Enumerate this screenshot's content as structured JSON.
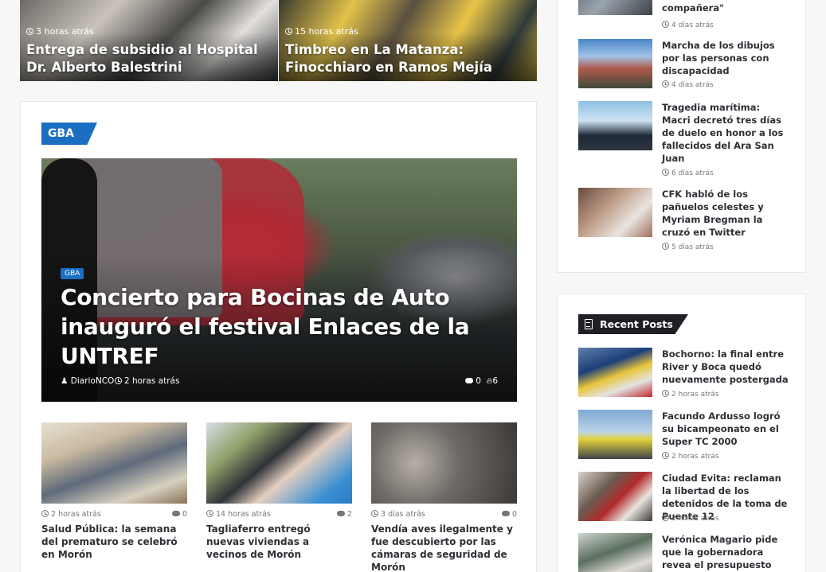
{
  "top_cards": [
    {
      "time": "3 horas atrás",
      "title": "Entrega de subsidio al Hospital Dr. Alberto Balestrini"
    },
    {
      "time": "15 horas atrás",
      "title": "Timbreo en La Matanza: Finocchiaro en Ramos Mejía"
    }
  ],
  "main": {
    "section_label": "GBA",
    "hero": {
      "badge": "GBA",
      "title": "Concierto para Bocinas de Auto inauguró el festival Enlaces de la UNTREF",
      "author": "DiarioNCO",
      "time": "2 horas atrás",
      "comments": "0",
      "views": "6"
    },
    "grid": [
      {
        "time": "2 horas atrás",
        "comments": "0",
        "title": "Salud Pública: la semana del prematuro se celebró en Morón"
      },
      {
        "time": "14 horas atrás",
        "comments": "2",
        "title": "Tagliaferro entregó nuevas viviendas a vecinos de Morón"
      },
      {
        "time": "3 días atrás",
        "comments": "0",
        "title": "Vendía aves ilegalmente y fue descubierto por las cámaras de seguridad de Morón"
      }
    ]
  },
  "sidebar_top": {
    "items": [
      {
        "title": "compañera\"",
        "time": "4 días atrás"
      },
      {
        "title": "Marcha de los dibujos por las personas con discapacidad",
        "time": "4 días atrás"
      },
      {
        "title": "Tragedia marítima: Macri decretó tres días de duelo en honor a los fallecidos del Ara San Juan",
        "time": "6 días atrás"
      },
      {
        "title": "CFK habló de los pañuelos celestes y Myriam Bregman la cruzó en Twitter",
        "time": "5 días atrás"
      }
    ]
  },
  "recent_posts": {
    "title": "Recent Posts",
    "items": [
      {
        "title": "Bochorno: la final entre River y Boca quedó nuevamente postergada",
        "time": "2 horas atrás"
      },
      {
        "title": "Facundo Ardusso logró su bicampeonato en el Super TC 2000",
        "time": "2 horas atrás"
      },
      {
        "title": "Ciudad Evita: reclaman la libertad de los detenidos de la toma de Puente 12",
        "time": "2 horas atrás"
      },
      {
        "title": "Verónica Magario pide que la gobernadora revea el presupuesto",
        "time": ""
      }
    ]
  },
  "colors": {
    "accent": "#1b6fc2",
    "dark": "#1f2024"
  }
}
